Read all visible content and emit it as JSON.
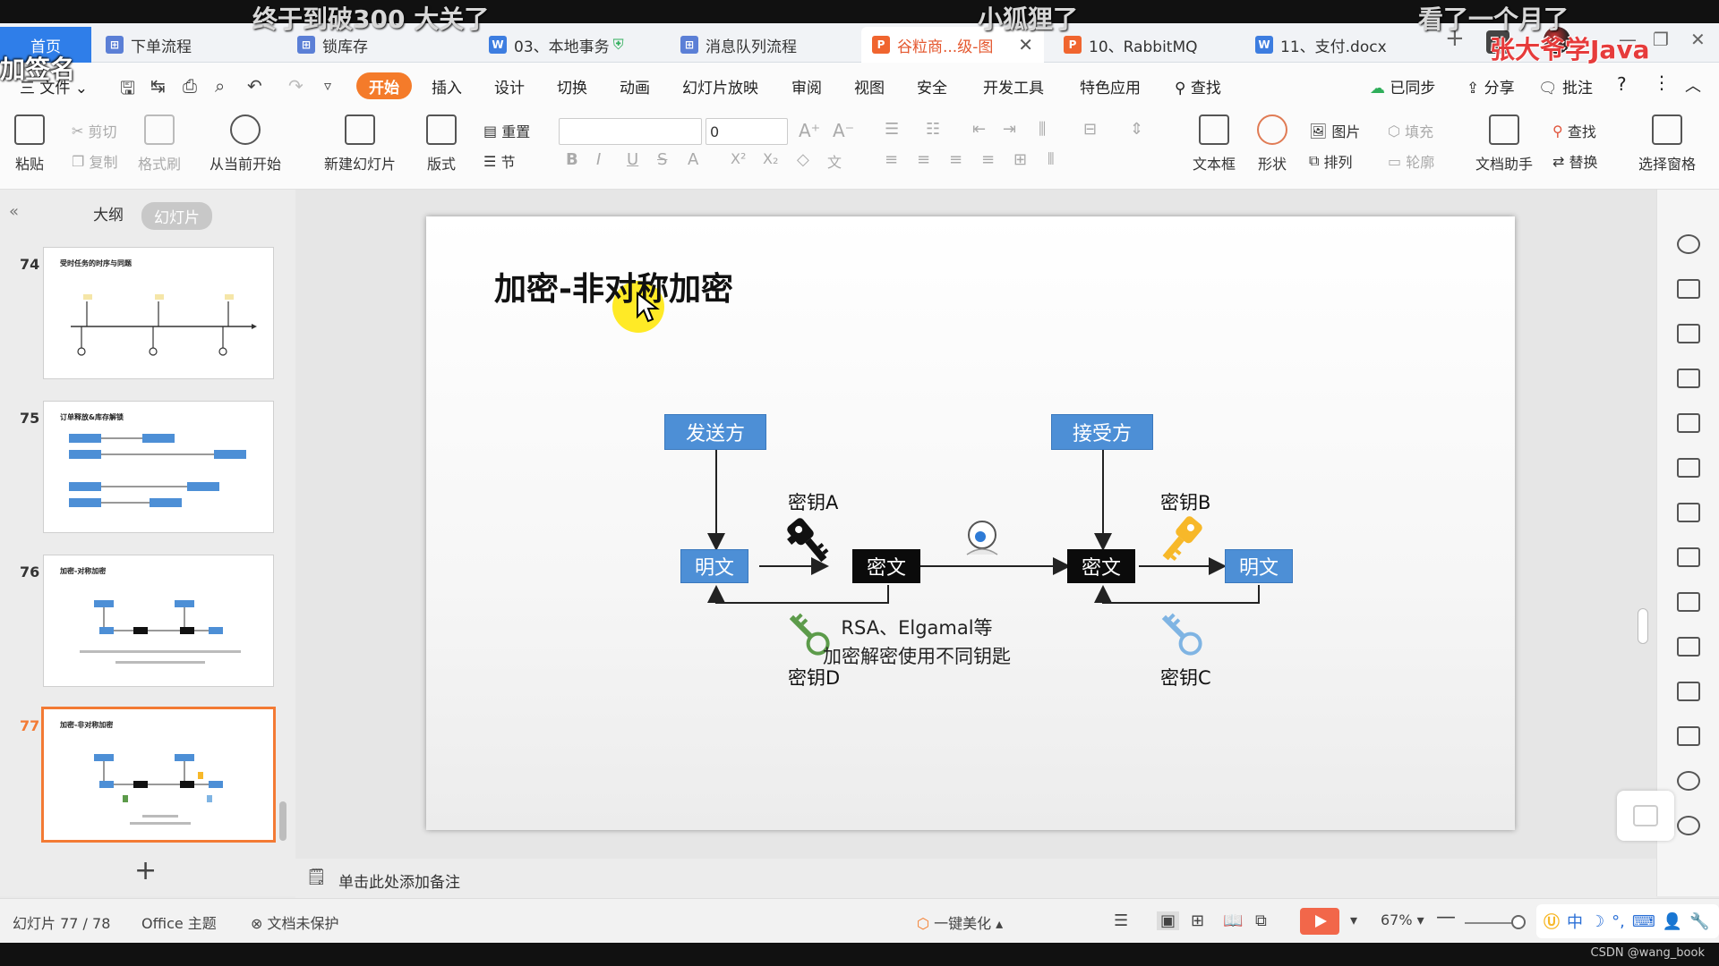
{
  "overlay": {
    "danmaku": [
      "终于到破300 大关了",
      "小狐狸了",
      "看了一个月了",
      "张大爷学Java",
      "加签名"
    ],
    "watermark": "CSDN @wang_book"
  },
  "tabs": {
    "home": "首页",
    "items": [
      {
        "label": "下单流程",
        "type": "flow"
      },
      {
        "label": "锁库存",
        "type": "flow"
      },
      {
        "label": "03、本地事务",
        "type": "word"
      },
      {
        "label": "消息队列流程",
        "type": "flow"
      },
      {
        "label": "谷粒商...级-图",
        "type": "ppt",
        "active": true
      },
      {
        "label": "10、RabbitMQ",
        "type": "ppt"
      },
      {
        "label": "11、支付.docx",
        "type": "word"
      }
    ],
    "new_tab": "+",
    "close_glyph": "✕"
  },
  "menu": {
    "file": "三 文件",
    "start": "开始",
    "items": [
      "插入",
      "设计",
      "切换",
      "动画",
      "幻灯片放映",
      "审阅",
      "视图",
      "安全",
      "开发工具",
      "特色应用"
    ],
    "search": "查找",
    "sync": "已同步",
    "share": "分享",
    "comment": "批注",
    "help": "?"
  },
  "ribbon": {
    "paste": "粘贴",
    "cut": "剪切",
    "copy": "复制",
    "format_painter": "格式刷",
    "from_current": "从当前开始",
    "new_slide": "新建幻灯片",
    "layout": "版式",
    "reset": "重置",
    "section": "节",
    "font_size": "0",
    "textbox": "文本框",
    "shape": "形状",
    "picture": "图片",
    "arrange": "排列",
    "fill": "填充",
    "outline": "轮廓",
    "doc_assistant": "文档助手",
    "find": "查找",
    "replace": "替换",
    "selection_pane": "选择窗格"
  },
  "left_panel": {
    "outline_tab": "大纲",
    "slides_tab": "幻灯片",
    "thumbnails": [
      {
        "num": "74",
        "title": "受时任务的时序与同题"
      },
      {
        "num": "75",
        "title": "订单释放&库存解锁"
      },
      {
        "num": "76",
        "title": "加密-对称加密"
      },
      {
        "num": "77",
        "title": "加密-非对称加密",
        "selected": true
      }
    ],
    "add": "+"
  },
  "slide": {
    "title": "加密-非对称加密",
    "sender": "发送方",
    "receiver": "接受方",
    "plaintext": "明文",
    "ciphertext": "密文",
    "key_a": "密钥A",
    "key_b": "密钥B",
    "key_c": "密钥C",
    "key_d": "密钥D",
    "caption_line1": "RSA、Elgamal等",
    "caption_line2": "加密解密使用不同钥匙"
  },
  "notes": {
    "placeholder": "单击此处添加备注"
  },
  "status": {
    "slide_info": "幻灯片 77 / 78",
    "theme": "Office 主题",
    "protection": "文档未保护",
    "beautify": "一键美化",
    "zoom": "67%"
  },
  "colors": {
    "accent": "#2f7ee9",
    "start_orange": "#f47b2a",
    "node_blue": "#4d8fd6",
    "key_black": "#111111",
    "key_yellow": "#f7b829",
    "key_green": "#5c9b4a",
    "key_lightblue": "#7fb4e3"
  }
}
